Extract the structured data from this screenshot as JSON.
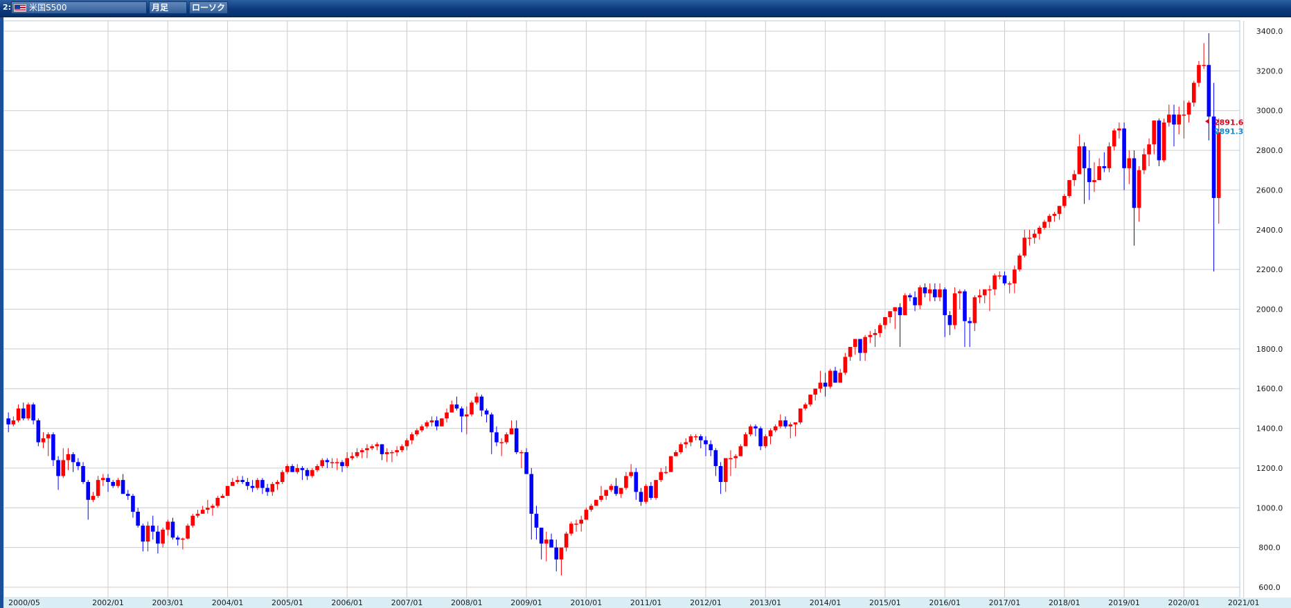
{
  "toolbar": {
    "index": "2:",
    "symbol": "米国S500",
    "flag_icon": "us-flag-icon",
    "period_label": "月足",
    "chart_type_label": "ローソク"
  },
  "chart_data": {
    "type": "candlestick",
    "title": "",
    "ylim": [
      580,
      3440
    ],
    "y_ticks": [
      "600.0",
      "800.0",
      "1000.0",
      "1200.0",
      "1400.0",
      "1600.0",
      "1800.0",
      "2000.0",
      "2200.0",
      "2400.0",
      "2600.0",
      "2800.0",
      "3000.0",
      "3200.0",
      "3400.0"
    ],
    "x_ticks": [
      "2000/05",
      "2002/01",
      "2003/01",
      "2004/01",
      "2005/01",
      "2006/01",
      "2007/01",
      "2008/01",
      "2009/01",
      "2010/01",
      "2011/01",
      "2012/01",
      "2013/01",
      "2014/01",
      "2015/01",
      "2016/01",
      "2017/01",
      "2018/01",
      "2019/01",
      "2020/01",
      "2021/01"
    ],
    "grid": true,
    "colors": {
      "up": "#ff0000",
      "down": "#0000ff",
      "grid": "#cccccc",
      "axis_band": "#d8eef4"
    },
    "last_price_labels": [
      {
        "value": "2891.6",
        "color": "#e8001c"
      },
      {
        "value": "2891.3",
        "color": "#1a86c7"
      }
    ],
    "start": "2000-05",
    "candles": [
      [
        1450,
        1480,
        1380,
        1420
      ],
      [
        1420,
        1460,
        1410,
        1440
      ],
      [
        1440,
        1520,
        1430,
        1500
      ],
      [
        1500,
        1530,
        1440,
        1450
      ],
      [
        1450,
        1530,
        1440,
        1520
      ],
      [
        1520,
        1530,
        1420,
        1440
      ],
      [
        1440,
        1450,
        1310,
        1330
      ],
      [
        1330,
        1380,
        1300,
        1350
      ],
      [
        1350,
        1380,
        1260,
        1370
      ],
      [
        1370,
        1380,
        1210,
        1240
      ],
      [
        1240,
        1260,
        1090,
        1160
      ],
      [
        1160,
        1300,
        1150,
        1240
      ],
      [
        1240,
        1300,
        1190,
        1270
      ],
      [
        1270,
        1280,
        1180,
        1230
      ],
      [
        1230,
        1250,
        1190,
        1210
      ],
      [
        1210,
        1230,
        1120,
        1130
      ],
      [
        1130,
        1140,
        940,
        1040
      ],
      [
        1040,
        1080,
        1030,
        1060
      ],
      [
        1060,
        1160,
        1050,
        1140
      ],
      [
        1140,
        1170,
        1110,
        1150
      ],
      [
        1150,
        1170,
        1080,
        1130
      ],
      [
        1130,
        1140,
        1100,
        1110
      ],
      [
        1110,
        1150,
        1100,
        1140
      ],
      [
        1140,
        1170,
        1080,
        1070
      ],
      [
        1070,
        1090,
        1040,
        1060
      ],
      [
        1060,
        1070,
        950,
        980
      ],
      [
        980,
        1000,
        900,
        910
      ],
      [
        910,
        920,
        780,
        830
      ],
      [
        830,
        930,
        780,
        910
      ],
      [
        910,
        960,
        840,
        880
      ],
      [
        880,
        910,
        770,
        820
      ],
      [
        820,
        900,
        800,
        890
      ],
      [
        890,
        940,
        860,
        930
      ],
      [
        930,
        950,
        840,
        850
      ],
      [
        850,
        860,
        810,
        840
      ],
      [
        840,
        850,
        790,
        845
      ],
      [
        845,
        920,
        840,
        910
      ],
      [
        910,
        970,
        900,
        960
      ],
      [
        960,
        990,
        950,
        970
      ],
      [
        970,
        1010,
        970,
        990
      ],
      [
        990,
        1040,
        970,
        1000
      ],
      [
        1000,
        1020,
        960,
        1010
      ],
      [
        1010,
        1060,
        1000,
        1050
      ],
      [
        1050,
        1070,
        1050,
        1060
      ],
      [
        1060,
        1100,
        1060,
        1110
      ],
      [
        1110,
        1150,
        1110,
        1130
      ],
      [
        1130,
        1160,
        1120,
        1140
      ],
      [
        1140,
        1160,
        1120,
        1130
      ],
      [
        1130,
        1150,
        1090,
        1110
      ],
      [
        1110,
        1140,
        1080,
        1100
      ],
      [
        1100,
        1150,
        1090,
        1140
      ],
      [
        1140,
        1150,
        1070,
        1100
      ],
      [
        1100,
        1120,
        1060,
        1080
      ],
      [
        1080,
        1130,
        1060,
        1120
      ],
      [
        1120,
        1140,
        1090,
        1130
      ],
      [
        1130,
        1190,
        1120,
        1180
      ],
      [
        1180,
        1220,
        1170,
        1210
      ],
      [
        1210,
        1220,
        1180,
        1180
      ],
      [
        1180,
        1220,
        1170,
        1200
      ],
      [
        1200,
        1210,
        1140,
        1190
      ],
      [
        1190,
        1200,
        1140,
        1160
      ],
      [
        1160,
        1200,
        1150,
        1190
      ],
      [
        1190,
        1220,
        1180,
        1210
      ],
      [
        1210,
        1250,
        1200,
        1240
      ],
      [
        1240,
        1250,
        1200,
        1230
      ],
      [
        1230,
        1250,
        1200,
        1230
      ],
      [
        1230,
        1250,
        1190,
        1230
      ],
      [
        1230,
        1240,
        1180,
        1210
      ],
      [
        1210,
        1280,
        1200,
        1250
      ],
      [
        1250,
        1280,
        1240,
        1260
      ],
      [
        1260,
        1300,
        1250,
        1280
      ],
      [
        1280,
        1300,
        1250,
        1290
      ],
      [
        1290,
        1320,
        1250,
        1300
      ],
      [
        1300,
        1320,
        1290,
        1310
      ],
      [
        1310,
        1330,
        1290,
        1320
      ],
      [
        1320,
        1320,
        1240,
        1270
      ],
      [
        1270,
        1300,
        1230,
        1280
      ],
      [
        1280,
        1290,
        1230,
        1280
      ],
      [
        1280,
        1310,
        1260,
        1290
      ],
      [
        1290,
        1320,
        1280,
        1310
      ],
      [
        1310,
        1350,
        1290,
        1340
      ],
      [
        1340,
        1380,
        1320,
        1370
      ],
      [
        1370,
        1400,
        1360,
        1390
      ],
      [
        1390,
        1420,
        1380,
        1410
      ],
      [
        1410,
        1440,
        1400,
        1430
      ],
      [
        1430,
        1460,
        1410,
        1440
      ],
      [
        1440,
        1460,
        1390,
        1410
      ],
      [
        1410,
        1450,
        1410,
        1450
      ],
      [
        1450,
        1500,
        1430,
        1480
      ],
      [
        1480,
        1540,
        1480,
        1520
      ],
      [
        1520,
        1560,
        1490,
        1500
      ],
      [
        1500,
        1510,
        1380,
        1460
      ],
      [
        1460,
        1510,
        1370,
        1470
      ],
      [
        1470,
        1540,
        1460,
        1530
      ],
      [
        1530,
        1580,
        1520,
        1560
      ],
      [
        1560,
        1570,
        1460,
        1490
      ],
      [
        1490,
        1500,
        1430,
        1470
      ],
      [
        1470,
        1480,
        1270,
        1380
      ],
      [
        1380,
        1410,
        1310,
        1330
      ],
      [
        1330,
        1350,
        1260,
        1330
      ],
      [
        1330,
        1380,
        1320,
        1370
      ],
      [
        1370,
        1440,
        1370,
        1400
      ],
      [
        1400,
        1440,
        1270,
        1280
      ],
      [
        1280,
        1290,
        1200,
        1280
      ],
      [
        1280,
        1300,
        1200,
        1170
      ],
      [
        1170,
        1200,
        840,
        970
      ],
      [
        970,
        1010,
        840,
        900
      ],
      [
        900,
        900,
        740,
        820
      ],
      [
        820,
        880,
        730,
        840
      ],
      [
        840,
        870,
        800,
        800
      ],
      [
        800,
        840,
        680,
        740
      ],
      [
        740,
        760,
        660,
        800
      ],
      [
        800,
        880,
        780,
        870
      ],
      [
        870,
        930,
        860,
        920
      ],
      [
        920,
        940,
        880,
        920
      ],
      [
        920,
        960,
        880,
        940
      ],
      [
        940,
        1000,
        940,
        990
      ],
      [
        990,
        1020,
        980,
        1010
      ],
      [
        1010,
        1040,
        1010,
        1040
      ],
      [
        1040,
        1110,
        1030,
        1060
      ],
      [
        1060,
        1080,
        1040,
        1090
      ],
      [
        1090,
        1120,
        1080,
        1110
      ],
      [
        1110,
        1150,
        1060,
        1070
      ],
      [
        1070,
        1100,
        1050,
        1100
      ],
      [
        1100,
        1180,
        1090,
        1160
      ],
      [
        1160,
        1220,
        1150,
        1180
      ],
      [
        1180,
        1200,
        1040,
        1080
      ],
      [
        1080,
        1100,
        1010,
        1030
      ],
      [
        1030,
        1120,
        1020,
        1110
      ],
      [
        1110,
        1130,
        1040,
        1050
      ],
      [
        1050,
        1130,
        1040,
        1140
      ],
      [
        1140,
        1200,
        1130,
        1180
      ],
      [
        1180,
        1210,
        1170,
        1180
      ],
      [
        1180,
        1260,
        1180,
        1260
      ],
      [
        1260,
        1290,
        1260,
        1280
      ],
      [
        1280,
        1330,
        1270,
        1320
      ],
      [
        1320,
        1350,
        1300,
        1330
      ],
      [
        1330,
        1370,
        1310,
        1360
      ],
      [
        1360,
        1370,
        1340,
        1360
      ],
      [
        1360,
        1370,
        1300,
        1340
      ],
      [
        1340,
        1360,
        1260,
        1320
      ],
      [
        1320,
        1340,
        1260,
        1290
      ],
      [
        1290,
        1300,
        1160,
        1210
      ],
      [
        1210,
        1230,
        1070,
        1130
      ],
      [
        1130,
        1230,
        1080,
        1250
      ],
      [
        1250,
        1290,
        1160,
        1250
      ],
      [
        1250,
        1270,
        1200,
        1260
      ],
      [
        1260,
        1320,
        1260,
        1310
      ],
      [
        1310,
        1380,
        1310,
        1370
      ],
      [
        1370,
        1420,
        1360,
        1410
      ],
      [
        1410,
        1420,
        1360,
        1400
      ],
      [
        1400,
        1410,
        1290,
        1310
      ],
      [
        1310,
        1370,
        1300,
        1360
      ],
      [
        1360,
        1400,
        1320,
        1390
      ],
      [
        1390,
        1420,
        1380,
        1410
      ],
      [
        1410,
        1470,
        1400,
        1440
      ],
      [
        1440,
        1460,
        1400,
        1410
      ],
      [
        1410,
        1430,
        1350,
        1420
      ],
      [
        1420,
        1430,
        1360,
        1430
      ],
      [
        1430,
        1500,
        1420,
        1500
      ],
      [
        1500,
        1530,
        1490,
        1520
      ],
      [
        1520,
        1570,
        1510,
        1570
      ],
      [
        1570,
        1600,
        1540,
        1600
      ],
      [
        1600,
        1690,
        1580,
        1630
      ],
      [
        1630,
        1680,
        1560,
        1610
      ],
      [
        1610,
        1700,
        1600,
        1690
      ],
      [
        1690,
        1710,
        1630,
        1630
      ],
      [
        1630,
        1700,
        1630,
        1680
      ],
      [
        1680,
        1780,
        1670,
        1760
      ],
      [
        1760,
        1810,
        1740,
        1810
      ],
      [
        1810,
        1850,
        1770,
        1850
      ],
      [
        1850,
        1850,
        1740,
        1780
      ],
      [
        1780,
        1870,
        1740,
        1860
      ],
      [
        1860,
        1890,
        1830,
        1870
      ],
      [
        1870,
        1900,
        1810,
        1880
      ],
      [
        1880,
        1930,
        1860,
        1920
      ],
      [
        1920,
        1960,
        1900,
        1960
      ],
      [
        1960,
        1990,
        1930,
        1990
      ],
      [
        1990,
        2010,
        1900,
        2010
      ],
      [
        2010,
        2030,
        1810,
        1970
      ],
      [
        1970,
        2080,
        1970,
        2070
      ],
      [
        2070,
        2080,
        2040,
        2060
      ],
      [
        2060,
        2090,
        1990,
        2020
      ],
      [
        2020,
        2120,
        2000,
        2110
      ],
      [
        2110,
        2130,
        2060,
        2080
      ],
      [
        2080,
        2130,
        2040,
        2100
      ],
      [
        2100,
        2130,
        2040,
        2060
      ],
      [
        2060,
        2130,
        2040,
        2100
      ],
      [
        2100,
        2110,
        1860,
        1970
      ],
      [
        1970,
        1990,
        1870,
        1920
      ],
      [
        1920,
        2110,
        1900,
        2080
      ],
      [
        2080,
        2100,
        2000,
        2090
      ],
      [
        2090,
        2100,
        1810,
        1940
      ],
      [
        1940,
        1960,
        1810,
        1930
      ],
      [
        1930,
        2070,
        1890,
        2060
      ],
      [
        2060,
        2100,
        2030,
        2070
      ],
      [
        2070,
        2090,
        2030,
        2100
      ],
      [
        2100,
        2120,
        1990,
        2100
      ],
      [
        2100,
        2180,
        2070,
        2170
      ],
      [
        2170,
        2190,
        2150,
        2170
      ],
      [
        2170,
        2190,
        2120,
        2130
      ],
      [
        2130,
        2140,
        2080,
        2130
      ],
      [
        2130,
        2220,
        2080,
        2200
      ],
      [
        2200,
        2280,
        2190,
        2270
      ],
      [
        2270,
        2400,
        2260,
        2360
      ],
      [
        2360,
        2400,
        2320,
        2360
      ],
      [
        2360,
        2400,
        2330,
        2380
      ],
      [
        2380,
        2420,
        2350,
        2410
      ],
      [
        2410,
        2450,
        2400,
        2440
      ],
      [
        2440,
        2480,
        2410,
        2470
      ],
      [
        2470,
        2490,
        2440,
        2480
      ],
      [
        2480,
        2520,
        2450,
        2520
      ],
      [
        2520,
        2580,
        2510,
        2570
      ],
      [
        2570,
        2650,
        2560,
        2650
      ],
      [
        2650,
        2700,
        2620,
        2680
      ],
      [
        2680,
        2880,
        2680,
        2820
      ],
      [
        2820,
        2840,
        2530,
        2710
      ],
      [
        2710,
        2800,
        2550,
        2640
      ],
      [
        2640,
        2740,
        2590,
        2650
      ],
      [
        2650,
        2760,
        2650,
        2720
      ],
      [
        2720,
        2790,
        2690,
        2710
      ],
      [
        2710,
        2840,
        2690,
        2820
      ],
      [
        2820,
        2910,
        2800,
        2900
      ],
      [
        2900,
        2940,
        2860,
        2910
      ],
      [
        2910,
        2940,
        2600,
        2710
      ],
      [
        2710,
        2800,
        2630,
        2760
      ],
      [
        2760,
        2800,
        2320,
        2510
      ],
      [
        2510,
        2720,
        2440,
        2700
      ],
      [
        2700,
        2810,
        2680,
        2780
      ],
      [
        2780,
        2860,
        2720,
        2830
      ],
      [
        2830,
        2950,
        2780,
        2950
      ],
      [
        2950,
        2960,
        2720,
        2750
      ],
      [
        2750,
        2960,
        2740,
        2940
      ],
      [
        2940,
        3030,
        2920,
        2980
      ],
      [
        2980,
        3030,
        2820,
        2930
      ],
      [
        2930,
        3020,
        2880,
        2980
      ],
      [
        2980,
        3050,
        2860,
        2980
      ],
      [
        2980,
        3050,
        2940,
        3040
      ],
      [
        3040,
        3150,
        3020,
        3140
      ],
      [
        3140,
        3250,
        3120,
        3230
      ],
      [
        3230,
        3340,
        3210,
        3230
      ],
      [
        3230,
        3390,
        2850,
        2970
      ],
      [
        2970,
        3140,
        2190,
        2560
      ],
      [
        2560,
        2960,
        2430,
        2890
      ]
    ]
  }
}
